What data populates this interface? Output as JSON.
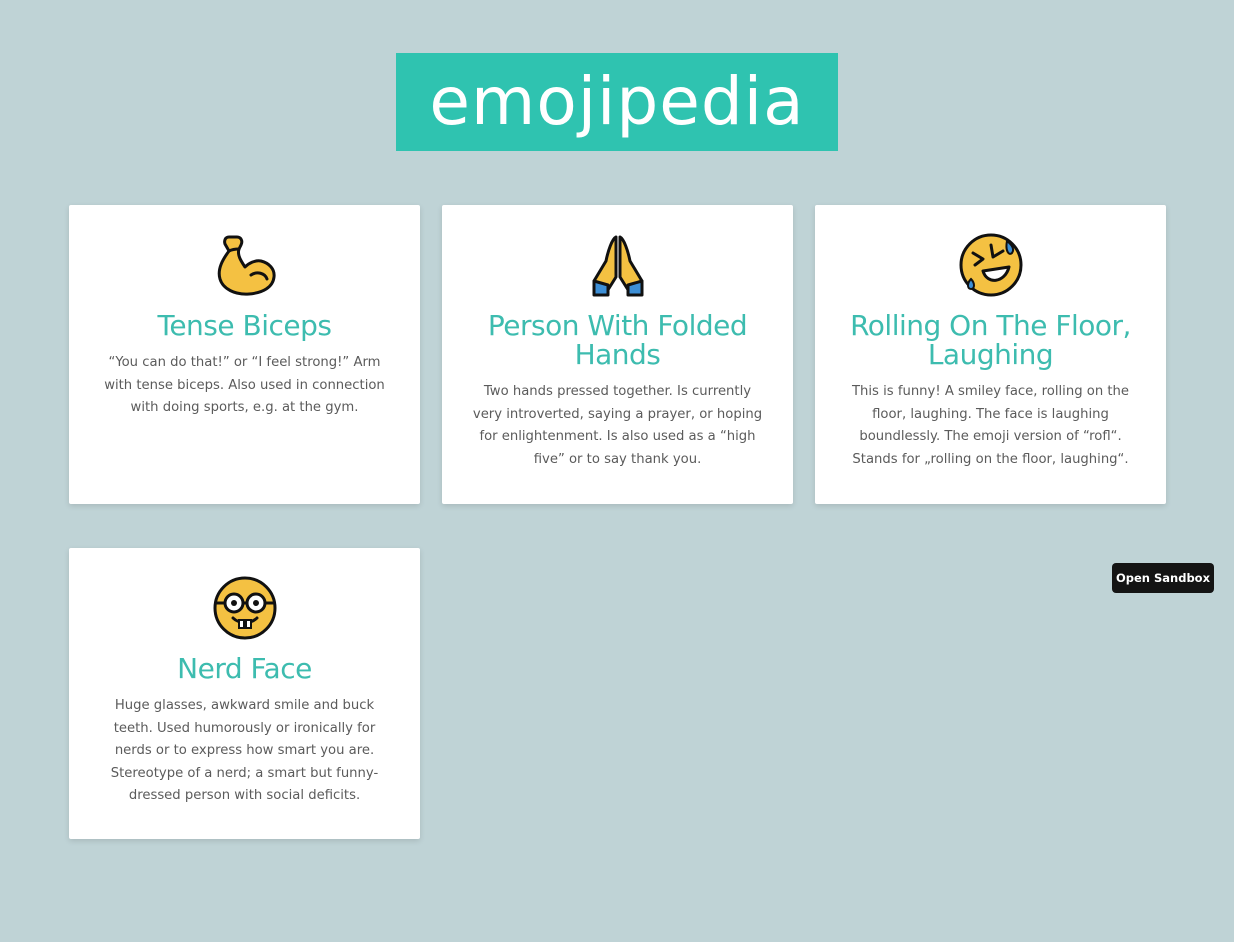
{
  "header": {
    "logo_text": "emojipedia"
  },
  "cards": [
    {
      "emoji_icon": "flexed-biceps",
      "title": "Tense Biceps",
      "description": "“You can do that!” or “I feel strong!” Arm with tense biceps. Also used in connection with doing sports, e.g. at the gym."
    },
    {
      "emoji_icon": "folded-hands",
      "title": "Person With Folded Hands",
      "description": "Two hands pressed together. Is currently very introverted, saying a prayer, or hoping for enlightenment. Is also used as a “high five” or to say thank you."
    },
    {
      "emoji_icon": "rolling-on-floor-laughing",
      "title": "Rolling On The Floor, Laughing",
      "description": "This is funny! A smiley face, rolling on the floor, laughing. The face is laughing boundlessly. The emoji version of “rofl“. Stands for „rolling on the floor, laughing“."
    },
    {
      "emoji_icon": "nerd-face",
      "title": "Nerd Face",
      "description": "Huge glasses, awkward smile and buck teeth. Used humorously or ironically for nerds or to express how smart you are. Stereotype of a nerd; a smart but funny-dressed person with social deficits."
    }
  ],
  "sandbox_button": {
    "label": "Open Sandbox"
  },
  "colors": {
    "background": "#bfd3d6",
    "brand": "#2fc3b0",
    "title": "#3dbcaf",
    "text": "#5b5b5b"
  }
}
